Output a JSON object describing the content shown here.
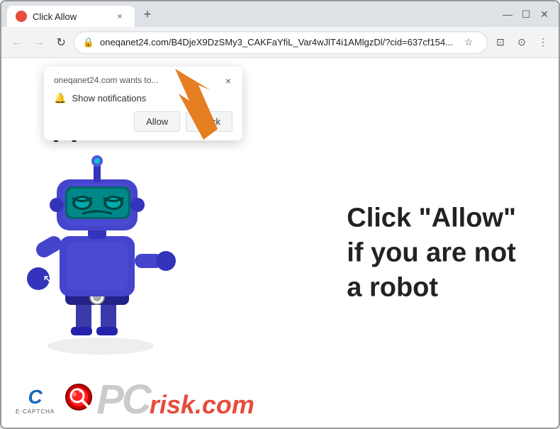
{
  "browser": {
    "tab": {
      "favicon_color": "#e74c3c",
      "title": "Click Allow",
      "close_label": "×"
    },
    "new_tab_label": "+",
    "window_controls": {
      "minimize": "—",
      "maximize": "☐",
      "close": "✕"
    },
    "nav": {
      "back_label": "←",
      "forward_label": "→",
      "reload_label": "↻",
      "address": "oneqanet24.com/B4DjeX9DzSMy3_CAKFaYfiL_Var4wJlT4i1AMlgzDl/?cid=637cf154...",
      "lock_icon": "🔒",
      "star_label": "☆",
      "extensions_label": "⊡",
      "account_label": "⊙",
      "menu_label": "⋮"
    }
  },
  "notification_popup": {
    "site_text": "oneqanet24.com wants to...",
    "close_label": "×",
    "bell_icon": "🔔",
    "show_notifications": "Show notifications",
    "allow_label": "Allow",
    "block_label": "Block"
  },
  "page": {
    "question_marks": "??",
    "main_text_line1": "Click \"Allow\"",
    "main_text_line2": "if you are not",
    "main_text_line3": "a robot"
  },
  "pcrisk": {
    "c_logo": "C",
    "ecaptcha_label": "E-CAPTCHA",
    "pc_text": "PC",
    "risk_text": "risk.com"
  }
}
